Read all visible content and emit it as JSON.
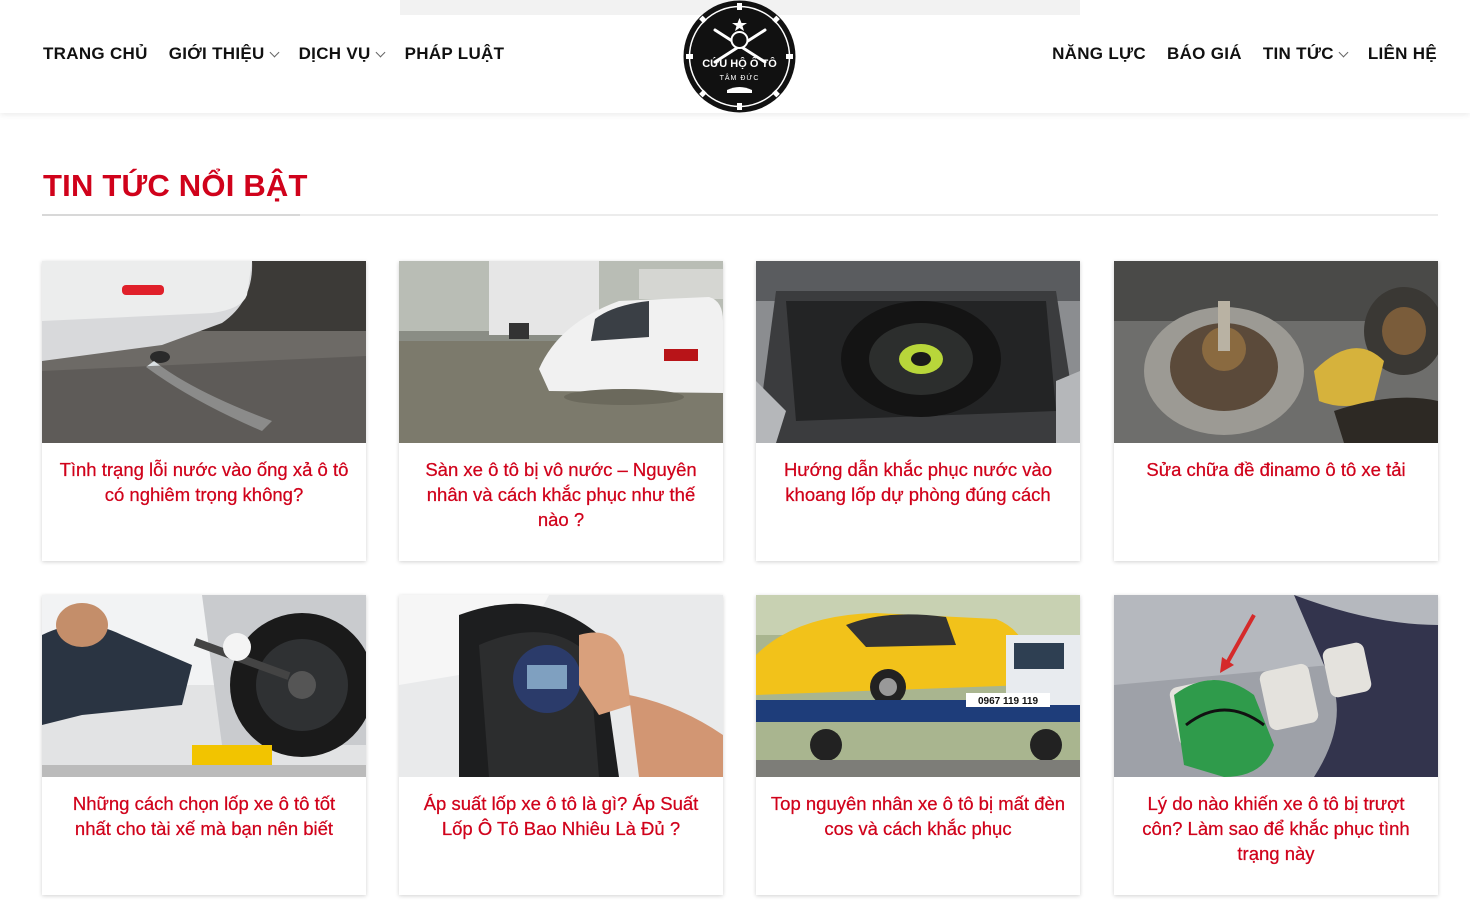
{
  "nav": {
    "left": [
      {
        "label": "TRANG CHỦ",
        "dropdown": false
      },
      {
        "label": "GIỚI THIỆU",
        "dropdown": true
      },
      {
        "label": "DỊCH VỤ",
        "dropdown": true
      },
      {
        "label": "PHÁP LUẬT",
        "dropdown": false
      }
    ],
    "right": [
      {
        "label": "NĂNG LỰC",
        "dropdown": false
      },
      {
        "label": "BÁO GIÁ",
        "dropdown": false
      },
      {
        "label": "TIN TỨC",
        "dropdown": true
      },
      {
        "label": "LIÊN HỆ",
        "dropdown": false
      }
    ]
  },
  "logo": {
    "line1": "CỨU HỘ Ô TÔ",
    "line2": "TÂM ĐỨC"
  },
  "section": {
    "title": "TIN TỨC NỔI BẬT"
  },
  "articles": [
    {
      "title": "Tình trạng lỗi nước vào ống xả ô tô có nghiêm trọng không?",
      "image": "exhaust-water-image"
    },
    {
      "title": "Sàn xe ô tô bị vô nước – Nguyên nhân và cách khắc phục như thế nào ?",
      "image": "flooded-car-image"
    },
    {
      "title": "Hướng dẫn khắc phục nước vào khoang lốp dự phòng đúng cách",
      "image": "spare-tire-trunk-image"
    },
    {
      "title": "Sửa chữa đề đinamo ô tô xe tải",
      "image": "alternator-repair-image"
    },
    {
      "title": "Những cách chọn lốp xe ô tô tốt nhất cho tài xế mà bạn nên biết",
      "image": "tire-change-image"
    },
    {
      "title": "Áp suất lốp xe ô tô là gì? Áp Suất Lốp Ô Tô Bao Nhiêu Là Đủ ?",
      "image": "tire-pressure-gauge-image"
    },
    {
      "title": "Top nguyên nhân xe ô tô bị mất đèn cos và cách khắc phục",
      "image": "tow-truck-image"
    },
    {
      "title": "Lý do nào khiến xe ô tô bị trượt côn? Làm sao để khắc phục tình trạng này",
      "image": "clutch-pedal-image"
    }
  ],
  "truck_plate": "0967 119 119",
  "colors": {
    "accent": "#d0021b",
    "nav_text": "#111111"
  }
}
